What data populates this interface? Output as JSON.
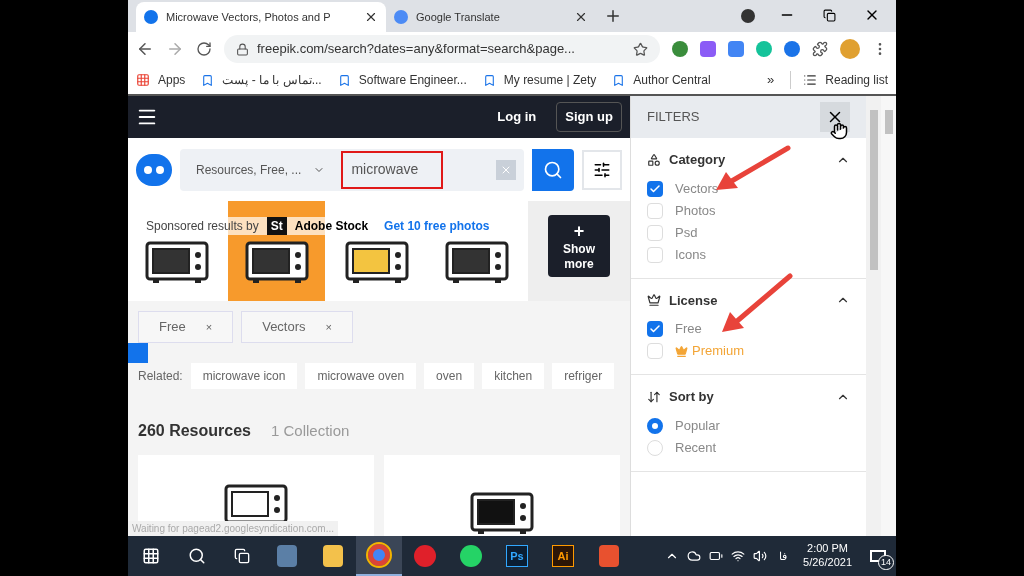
{
  "browser": {
    "tabs": [
      {
        "title": "Microwave Vectors, Photos and P",
        "selected": true
      },
      {
        "title": "Google Translate",
        "selected": false
      }
    ],
    "url": "freepik.com/search?dates=any&format=search&page...",
    "bookmarks": [
      {
        "label": "Apps"
      },
      {
        "label": "تماس با ما - پست..."
      },
      {
        "label": "Software Engineer..."
      },
      {
        "label": "My resume | Zety"
      },
      {
        "label": "Author Central"
      }
    ],
    "reading_list": "Reading list",
    "more_bookmarks": "»"
  },
  "header": {
    "login": "Log in",
    "signup": "Sign up"
  },
  "search": {
    "scope": "Resources, Free, ...",
    "query": "microwave"
  },
  "sponsored": {
    "label": "Sponsored results by",
    "brand_mark": "St",
    "brand": "Adobe Stock",
    "link": "Get 10 free photos",
    "show_more_icon": "+",
    "show_more": "Show\nmore"
  },
  "active_filters": [
    {
      "label": "Free",
      "remove": "×"
    },
    {
      "label": "Vectors",
      "remove": "×"
    }
  ],
  "related": {
    "label": "Related:",
    "tags": [
      "microwave icon",
      "microwave oven",
      "oven",
      "kitchen",
      "refriger"
    ]
  },
  "results": {
    "count": "260 Resources",
    "collections": "1 Collection"
  },
  "status_text": "Waiting for pagead2.googlesyndication.com...",
  "filters": {
    "title": "FILTERS",
    "sections": [
      {
        "title": "Category",
        "expanded": true,
        "kind": "checkbox",
        "options": [
          {
            "label": "Vectors",
            "checked": true
          },
          {
            "label": "Photos",
            "checked": false
          },
          {
            "label": "Psd",
            "checked": false
          },
          {
            "label": "Icons",
            "checked": false
          }
        ]
      },
      {
        "title": "License",
        "expanded": true,
        "kind": "checkbox",
        "options": [
          {
            "label": "Free",
            "checked": true
          },
          {
            "label": "Premium",
            "checked": false,
            "premium": true
          }
        ]
      },
      {
        "title": "Sort by",
        "expanded": true,
        "kind": "radio",
        "options": [
          {
            "label": "Popular",
            "selected": true
          },
          {
            "label": "Recent",
            "selected": false
          }
        ]
      }
    ]
  },
  "taskbar": {
    "apps": [
      {
        "kind": "calculator",
        "selected": false
      },
      {
        "kind": "folder",
        "selected": false
      },
      {
        "kind": "chrome",
        "selected": true
      },
      {
        "kind": "opera",
        "selected": false
      },
      {
        "kind": "whatsapp",
        "selected": false
      },
      {
        "kind": "ps",
        "label": "Ps",
        "selected": false
      },
      {
        "kind": "ai",
        "label": "Ai",
        "selected": false
      },
      {
        "kind": "camtasia",
        "selected": false
      }
    ],
    "language": "فا",
    "time": "2:00 PM",
    "date": "5/26/2021",
    "notifications": "14"
  }
}
